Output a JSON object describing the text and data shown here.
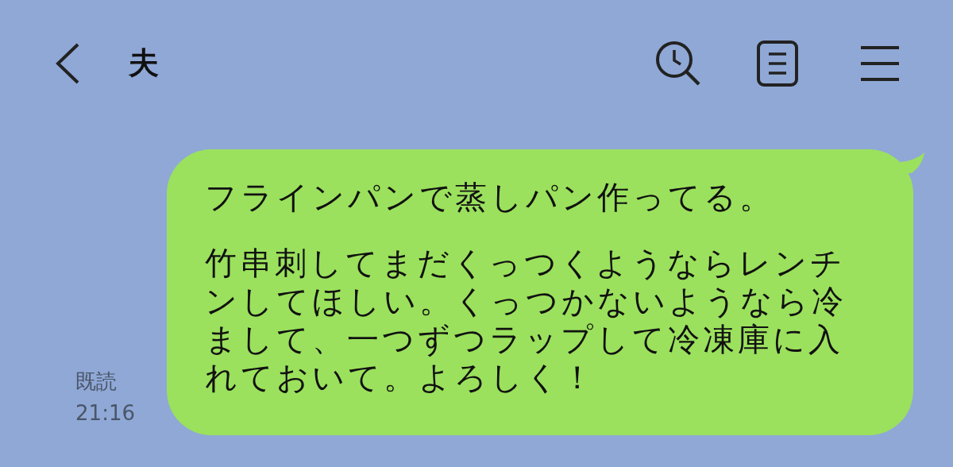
{
  "header": {
    "title": "夫"
  },
  "messages": [
    {
      "kind": "outgoing",
      "read_label": "既読",
      "time": "21:16",
      "paragraphs": [
        "フラインパンで蒸しパン作ってる。",
        "竹串刺してまだくっつくようならレンチンしてほしい。くっつかないようなら冷まして、一つずつラップして冷凍庫に入れておいて。よろしく！"
      ]
    }
  ]
}
